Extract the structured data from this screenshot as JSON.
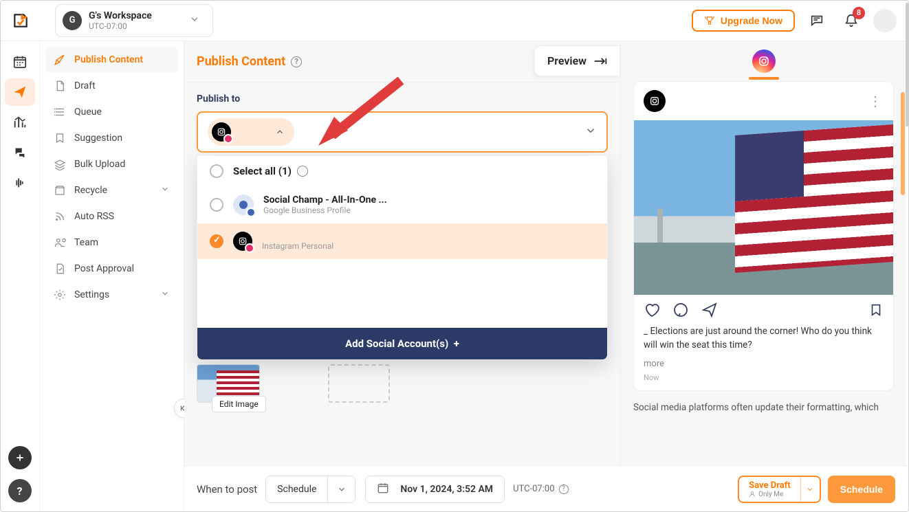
{
  "workspace": {
    "initial": "G",
    "name": "G's Workspace",
    "tz": "UTC-07:00"
  },
  "header": {
    "upgrade": "Upgrade Now",
    "notif_count": "8"
  },
  "sidebar": {
    "items": [
      {
        "label": "Publish Content"
      },
      {
        "label": "Draft"
      },
      {
        "label": "Queue"
      },
      {
        "label": "Suggestion"
      },
      {
        "label": "Bulk Upload"
      },
      {
        "label": "Recycle"
      },
      {
        "label": "Auto RSS"
      },
      {
        "label": "Team"
      },
      {
        "label": "Post Approval"
      },
      {
        "label": "Settings"
      }
    ]
  },
  "main": {
    "title": "Publish Content",
    "preview": "Preview",
    "publish_to": "Publish to",
    "edit_image": "Edit Image",
    "dropdown": {
      "select_all": "Select all (1)",
      "acc1": {
        "name": "Social Champ - All-In-One ...",
        "sub": "Google Business Profile"
      },
      "acc2": {
        "name": "",
        "sub": "Instagram Personal"
      },
      "add": "Add Social Account(s)"
    }
  },
  "preview": {
    "caption": "_ Elections are just around the corner! Who do you think will win the seat this time?",
    "more": "more",
    "time": "Now",
    "note": "Social media platforms often update their formatting, which"
  },
  "bottom": {
    "when": "When to post",
    "mode": "Schedule",
    "date": "Nov 1, 2024, 3:52 AM",
    "tz": "UTC-07:00",
    "save": "Save Draft",
    "only": "Only Me",
    "schedule": "Schedule"
  }
}
